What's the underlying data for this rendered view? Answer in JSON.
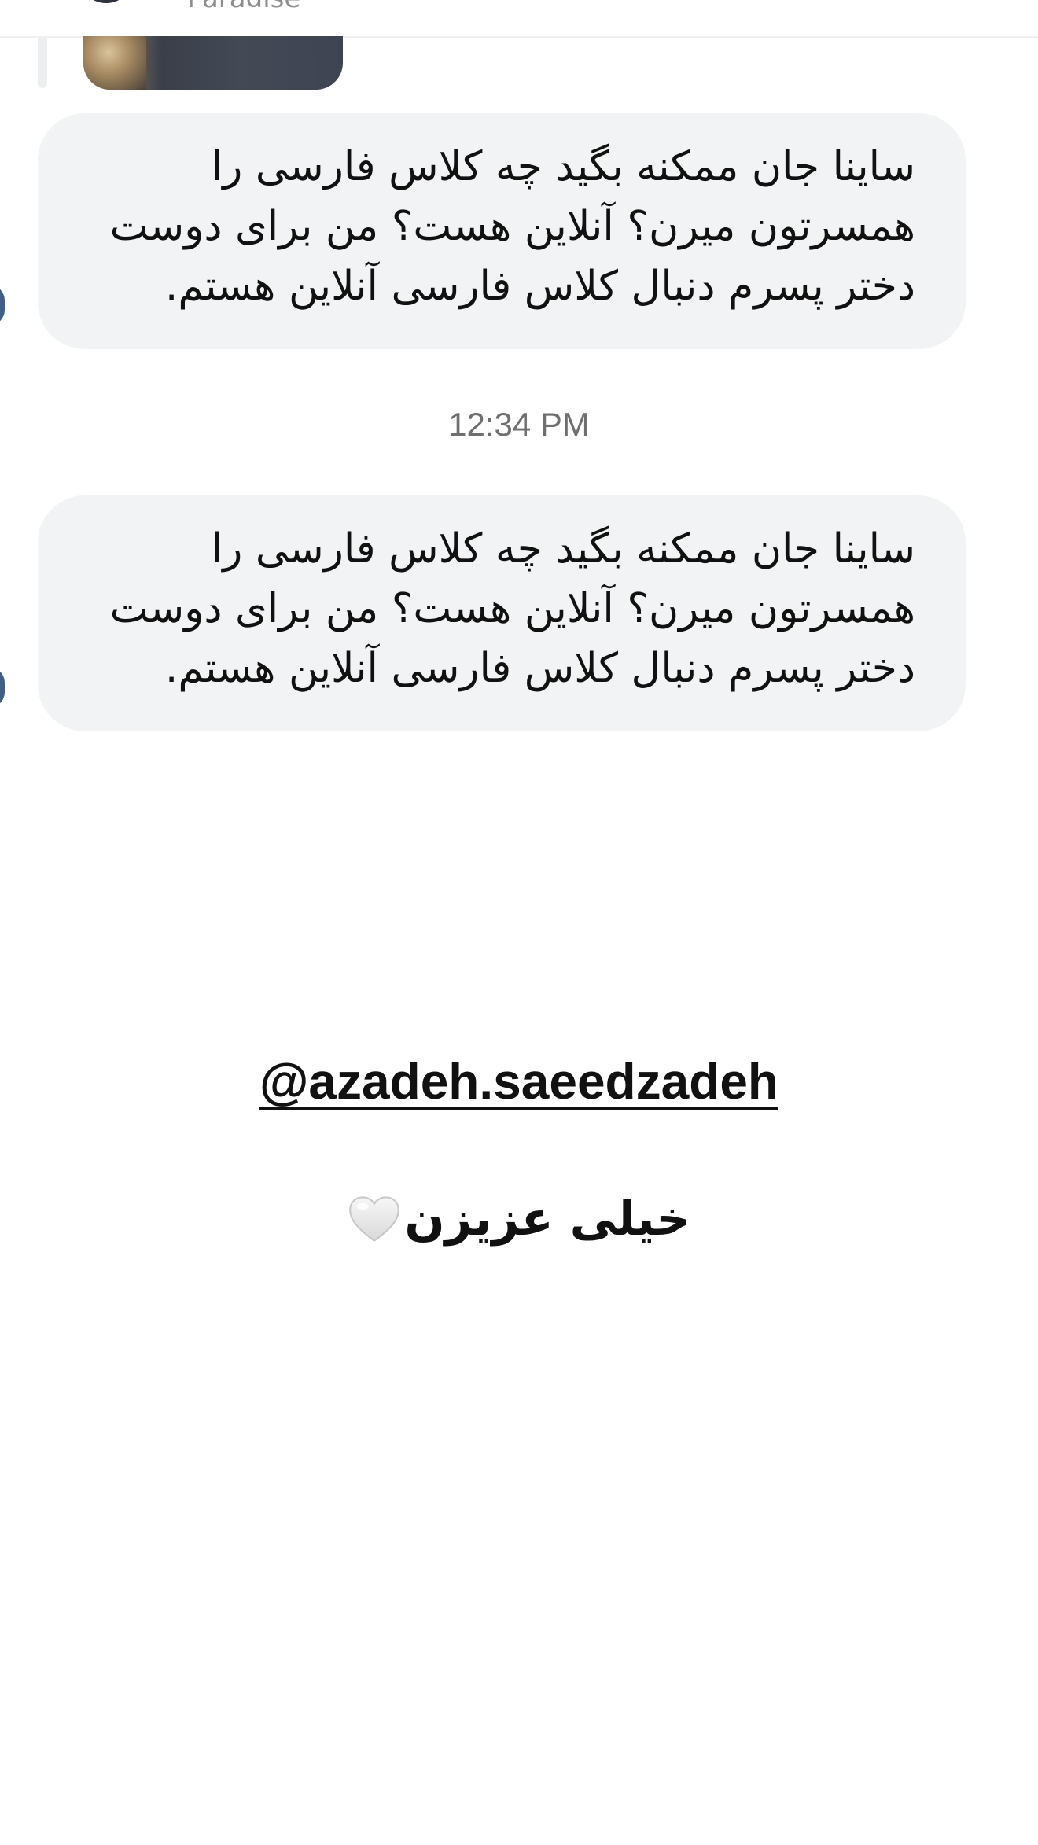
{
  "conversation": {
    "header": {
      "name": "Paradise"
    },
    "messages": [
      {
        "text": "ساینا جان ممکنه بگید چه کلاس فارسی را همسرتون میرن؟ آنلاین هست؟ من برای دوست دختر پسرم دنبال کلاس فارسی آنلاین هستم."
      },
      {
        "text": "ساینا جان ممکنه بگید چه کلاس فارسی را همسرتون میرن؟ آنلاین هست؟ من برای دوست دختر پسرم دنبال کلاس فارسی آنلاین هستم."
      }
    ],
    "timestamp": "12:34 PM"
  },
  "story_overlay": {
    "mention": "@azadeh.saeedzadeh",
    "caption": "خیلی عزیزن",
    "caption_icon": "white-heart-icon"
  },
  "colors": {
    "bubble_background": "#f2f3f5",
    "timestamp_text": "#6f6f6f",
    "text": "#111111"
  }
}
